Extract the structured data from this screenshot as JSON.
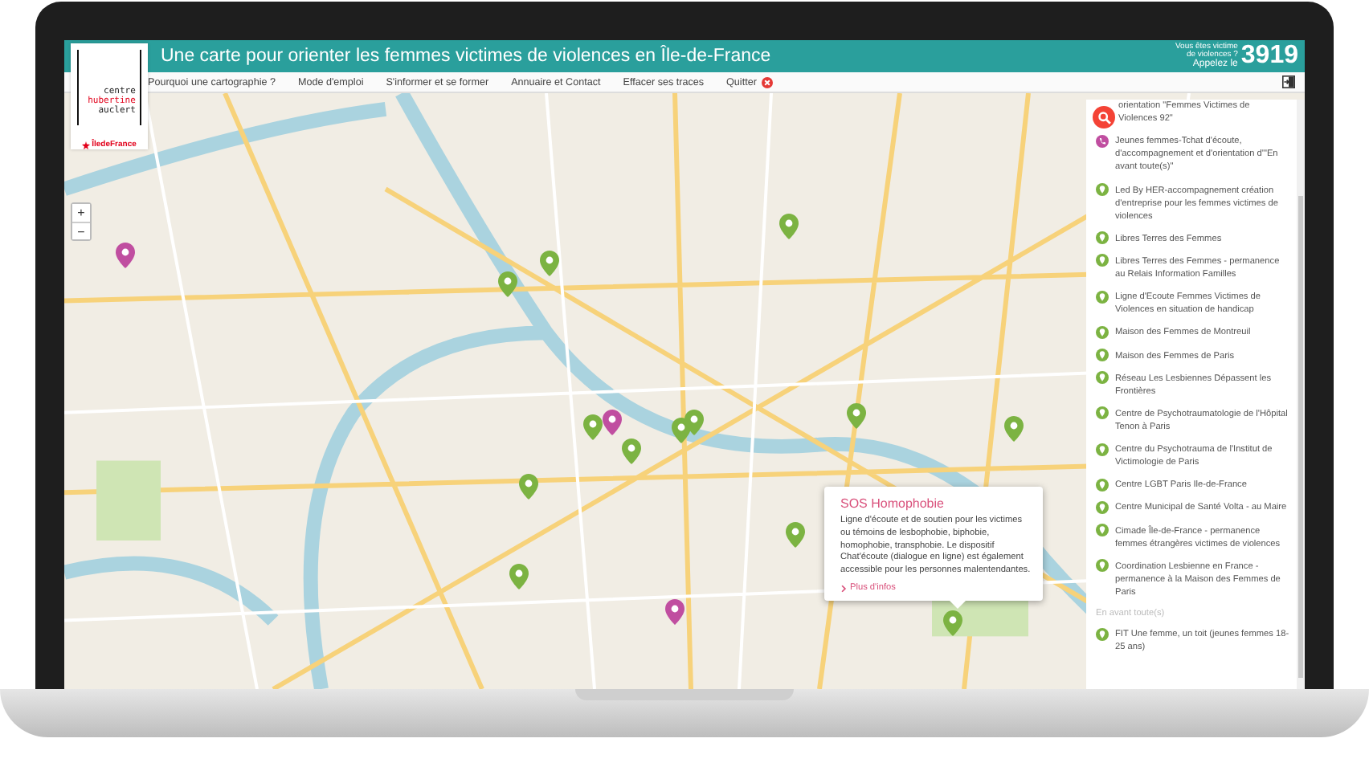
{
  "header": {
    "title": "Une carte pour orienter les femmes victimes de violences en Île-de-France",
    "helpline": {
      "line1": "Vous êtes victime",
      "line2": "de violences ?",
      "call": "Appelez le",
      "number": "3919"
    }
  },
  "logo": {
    "lines": [
      "centre",
      "hubertine",
      "auclert"
    ],
    "partner": "ÎledeFrance"
  },
  "nav": [
    {
      "label": "Pourquoi une cartographie ?",
      "kind": "link"
    },
    {
      "label": "Mode d'emploi",
      "kind": "link"
    },
    {
      "label": "S'informer et se former",
      "kind": "link"
    },
    {
      "label": "Annuaire et Contact",
      "kind": "link"
    },
    {
      "label": "Effacer ses traces",
      "kind": "link"
    },
    {
      "label": "Quitter",
      "kind": "quit"
    }
  ],
  "zoom_controls": [
    "+",
    "−"
  ],
  "markers": [
    {
      "color": "#c04ea0"
    },
    {
      "color": "#7cb342"
    },
    {
      "color": "#7cb342"
    },
    {
      "color": "#7cb342"
    },
    {
      "color": "#7cb342"
    },
    {
      "color": "#c04ea0"
    },
    {
      "color": "#7cb342"
    },
    {
      "color": "#7cb342"
    },
    {
      "color": "#7cb342"
    },
    {
      "color": "#7cb342"
    },
    {
      "color": "#7cb342"
    },
    {
      "color": "#7cb342"
    },
    {
      "color": "#7cb342"
    },
    {
      "color": "#7cb342"
    },
    {
      "color": "#c04ea0"
    },
    {
      "color": "#7cb342"
    }
  ],
  "popup": {
    "title": "SOS Homophobie",
    "text": "Ligne d'écoute et de soutien pour les victimes ou témoins de lesbophobie, biphobie, homophobie, transphobie. Le dispositif Chat'écoute (dialogue en ligne) est également accessible pour les personnes malentendantes.",
    "link": "Plus d'infos"
  },
  "sidebar": {
    "items": [
      {
        "kind": "text",
        "label": "orientation \"Femmes Victimes de Violences 92\""
      },
      {
        "kind": "phone",
        "color": "#c04ea0",
        "label": "Jeunes femmes-Tchat d'écoute, d'accompagnement et d'orientation d'\"En avant toute(s)\""
      },
      {
        "kind": "pin",
        "color": "#7cb342",
        "label": "Led By HER-accompagnement création d'entreprise pour les femmes victimes de violences"
      },
      {
        "kind": "pin",
        "color": "#7cb342",
        "label": "Libres Terres des Femmes"
      },
      {
        "kind": "pin",
        "color": "#7cb342",
        "label": "Libres Terres des Femmes - permanence au Relais Information Familles"
      },
      {
        "kind": "pin",
        "color": "#7cb342",
        "label": "Ligne d'Ecoute Femmes Victimes de Violences en situation de handicap"
      },
      {
        "kind": "pin",
        "color": "#7cb342",
        "label": "Maison des Femmes de Montreuil"
      },
      {
        "kind": "pin",
        "color": "#7cb342",
        "label": "Maison des Femmes de Paris"
      },
      {
        "kind": "pin",
        "color": "#7cb342",
        "label": "Réseau Les Lesbiennes Dépassent les Frontières"
      },
      {
        "kind": "pin",
        "color": "#7cb342",
        "label": "Centre de Psychotraumatologie de l'Hôpital Tenon à Paris"
      },
      {
        "kind": "pin",
        "color": "#7cb342",
        "label": "Centre du Psychotrauma de l'Institut de Victimologie de Paris"
      },
      {
        "kind": "pin",
        "color": "#7cb342",
        "label": "Centre LGBT Paris Ile-de-France"
      },
      {
        "kind": "pin",
        "color": "#7cb342",
        "label": "Centre Municipal de Santé Volta - au Maire"
      },
      {
        "kind": "pin",
        "color": "#7cb342",
        "label": "Cimade Île-de-France - permanence femmes étrangères victimes de violences"
      },
      {
        "kind": "pin",
        "color": "#7cb342",
        "label": "Coordination Lesbienne en France - permanence à la Maison des Femmes de Paris"
      },
      {
        "kind": "heading",
        "label": "En avant toute(s)"
      },
      {
        "kind": "pin",
        "color": "#7cb342",
        "label": "FIT Une femme, un toit (jeunes femmes 18-25 ans)"
      }
    ]
  }
}
